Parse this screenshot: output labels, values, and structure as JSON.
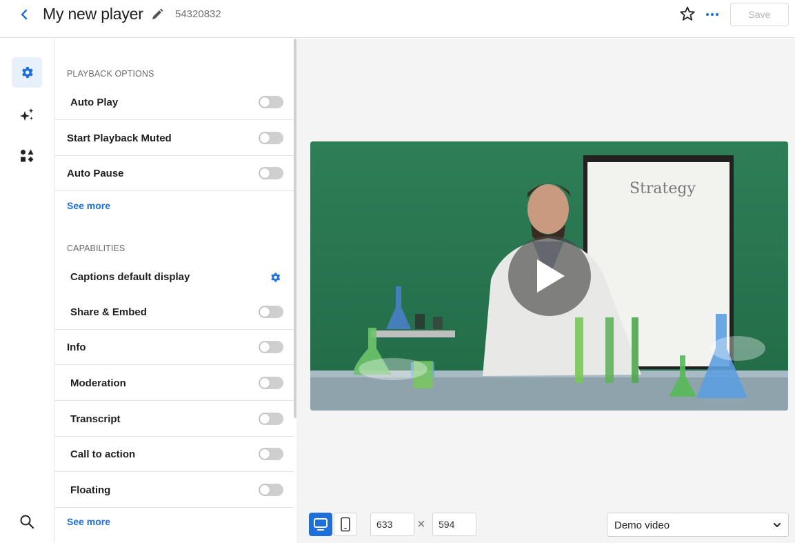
{
  "header": {
    "title": "My new player",
    "player_id": "54320832",
    "save_label": "Save"
  },
  "rail": {
    "items": [
      {
        "icon": "gear-icon",
        "active": true
      },
      {
        "icon": "sparkle-icon",
        "active": false
      },
      {
        "icon": "shapes-icon",
        "active": false
      }
    ],
    "bottom_icon": "search-icon"
  },
  "panel": {
    "playback": {
      "title": "PLAYBACK OPTIONS",
      "items": [
        {
          "label": "Auto Play",
          "on": false
        },
        {
          "label": "Start Playback Muted",
          "on": false
        },
        {
          "label": "Auto Pause",
          "on": false
        }
      ],
      "see_more": "See more"
    },
    "capabilities": {
      "title": "CAPABILITIES",
      "items": [
        {
          "label": "Captions default display",
          "control": "gear"
        },
        {
          "label": "Share & Embed",
          "on": false
        },
        {
          "label": "Info",
          "on": false
        },
        {
          "label": "Moderation",
          "on": false
        },
        {
          "label": "Transcript",
          "on": false
        },
        {
          "label": "Call to action",
          "on": false
        },
        {
          "label": "Floating",
          "on": false
        }
      ],
      "see_more": "See more"
    }
  },
  "preview": {
    "video_whiteboard_text": "Strategy",
    "width_value": "633",
    "height_value": "594",
    "dim_separator": "×",
    "video_select": "Demo video",
    "accent_color": "#1e6fd9"
  }
}
